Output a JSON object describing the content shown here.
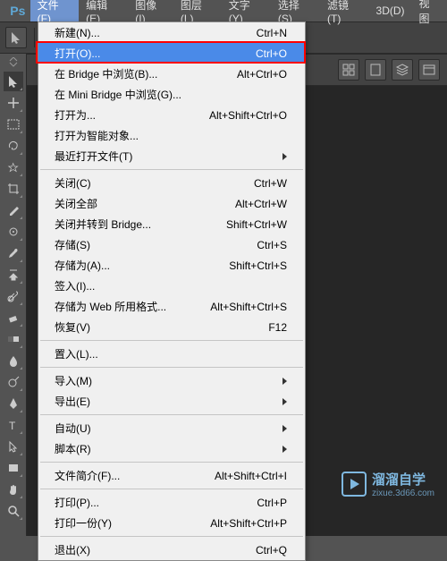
{
  "app": {
    "logo": "Ps"
  },
  "menubar": [
    {
      "label": "文件(F)",
      "active": true
    },
    {
      "label": "编辑(E)"
    },
    {
      "label": "图像(I)"
    },
    {
      "label": "图层(L)"
    },
    {
      "label": "文字(Y)"
    },
    {
      "label": "选择(S)"
    },
    {
      "label": "滤镜(T)"
    },
    {
      "label": "3D(D)"
    },
    {
      "label": "视图"
    }
  ],
  "dropdown": [
    {
      "type": "item",
      "label": "新建(N)...",
      "shortcut": "Ctrl+N"
    },
    {
      "type": "item",
      "label": "打开(O)...",
      "shortcut": "Ctrl+O",
      "highlighted": true,
      "redbox": true
    },
    {
      "type": "item",
      "label": "在 Bridge 中浏览(B)...",
      "shortcut": "Alt+Ctrl+O"
    },
    {
      "type": "item",
      "label": "在 Mini Bridge 中浏览(G)..."
    },
    {
      "type": "item",
      "label": "打开为...",
      "shortcut": "Alt+Shift+Ctrl+O"
    },
    {
      "type": "item",
      "label": "打开为智能对象..."
    },
    {
      "type": "item",
      "label": "最近打开文件(T)",
      "submenu": true
    },
    {
      "type": "sep"
    },
    {
      "type": "item",
      "label": "关闭(C)",
      "shortcut": "Ctrl+W"
    },
    {
      "type": "item",
      "label": "关闭全部",
      "shortcut": "Alt+Ctrl+W"
    },
    {
      "type": "item",
      "label": "关闭并转到 Bridge...",
      "shortcut": "Shift+Ctrl+W"
    },
    {
      "type": "item",
      "label": "存储(S)",
      "shortcut": "Ctrl+S"
    },
    {
      "type": "item",
      "label": "存储为(A)...",
      "shortcut": "Shift+Ctrl+S"
    },
    {
      "type": "item",
      "label": "签入(I)..."
    },
    {
      "type": "item",
      "label": "存储为 Web 所用格式...",
      "shortcut": "Alt+Shift+Ctrl+S"
    },
    {
      "type": "item",
      "label": "恢复(V)",
      "shortcut": "F12"
    },
    {
      "type": "sep"
    },
    {
      "type": "item",
      "label": "置入(L)..."
    },
    {
      "type": "sep"
    },
    {
      "type": "item",
      "label": "导入(M)",
      "submenu": true
    },
    {
      "type": "item",
      "label": "导出(E)",
      "submenu": true
    },
    {
      "type": "sep"
    },
    {
      "type": "item",
      "label": "自动(U)",
      "submenu": true
    },
    {
      "type": "item",
      "label": "脚本(R)",
      "submenu": true
    },
    {
      "type": "sep"
    },
    {
      "type": "item",
      "label": "文件简介(F)...",
      "shortcut": "Alt+Shift+Ctrl+I"
    },
    {
      "type": "sep"
    },
    {
      "type": "item",
      "label": "打印(P)...",
      "shortcut": "Ctrl+P"
    },
    {
      "type": "item",
      "label": "打印一份(Y)",
      "shortcut": "Alt+Shift+Ctrl+P"
    },
    {
      "type": "sep"
    },
    {
      "type": "item",
      "label": "退出(X)",
      "shortcut": "Ctrl+Q"
    }
  ],
  "tools": [
    "move",
    "expand",
    "marquee",
    "lasso",
    "quick-select",
    "crop",
    "eyedropper",
    "spot-heal",
    "brush",
    "clone",
    "history-brush",
    "eraser",
    "gradient",
    "blur",
    "dodge",
    "pen",
    "type",
    "path-select",
    "rectangle",
    "hand",
    "zoom"
  ],
  "watermark": {
    "title": "溜溜自学",
    "sub": "zixue.3d66.com"
  }
}
